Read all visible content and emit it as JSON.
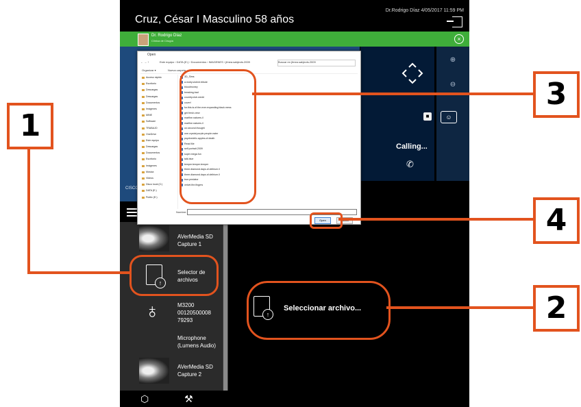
{
  "header": {
    "patient": "Cruz, César I Masculino 58 años",
    "doctor_date": "Dr.Rodrigo Díaz   4/05/2017 11:59 PM"
  },
  "doctor_bar": {
    "name": "Dr. Rodrigo Díaz",
    "subtitle": "Clínica de Cirugía"
  },
  "video": {
    "brand": "CISCO"
  },
  "call": {
    "status": "Calling..."
  },
  "menu": {
    "items": [
      {
        "label": "AVerMedia SD Capture 1",
        "icon": "xray-thumbnail"
      },
      {
        "label": "Selector de archivos",
        "icon": "file-upload-icon"
      },
      {
        "label": "M3200 00120500008 79293",
        "icon": "stethoscope-icon"
      },
      {
        "label": "Microphone (Lumens Audio)",
        "icon": ""
      },
      {
        "label": "AVerMedia SD Capture 2",
        "icon": "xray-thumbnail"
      }
    ]
  },
  "center": {
    "select_file": "Seleccionar archivo..."
  },
  "dialog": {
    "title": "Open",
    "address": "Este equipo  ›  DATA (E:)  ›  Documentos  ›  IMAGENES  ›  jfmea.sabjects.2009",
    "search_placeholder": "Buscar en jfmea.sabjects.2009",
    "organize": "Organizar ▾",
    "new_folder": "Nueva carpeta",
    "sidebar": [
      "Acceso rápido",
      "Escritorio",
      "Descargas",
      "Descargas",
      "Documentos",
      "Imágenes",
      "MINE",
      "Software",
      "TRABAJO",
      "OneDrive",
      "Este equipo",
      "Descargas",
      "Documentos",
      "Escritorio",
      "Imágenes",
      "Música",
      "Videos",
      "Disco local (C:)",
      "DATA (E:)",
      "Public (E:)"
    ],
    "files": [
      "3D_Sims",
      "a.moby.violent.tribute",
      "bloodmoney",
      "breaking.bad",
      "country.club.wedd",
      "cover!",
      "for.this.is.of.the.ever.expanding.black.mess",
      "get.fresh.crew",
      "marfine.natures.il",
      "marfine.natures.il",
      "on.second.thought",
      "one.crystal.purple.people.eater",
      "psychedelic.apples.of.death",
      "Read Me",
      "self.portrait.2009",
      "super.mega.fun",
      "talk.blue",
      "temper.temper.temper",
      "three.diamond.days.of.delirium.il",
      "three.diamond.days.of.delirium.il",
      "true.predator",
      "velvet.fire.fingers"
    ],
    "filename_label": "Nombre:",
    "open_button": "Open",
    "cancel_button": "Cancel"
  },
  "callouts": [
    "1",
    "2",
    "3",
    "4"
  ]
}
